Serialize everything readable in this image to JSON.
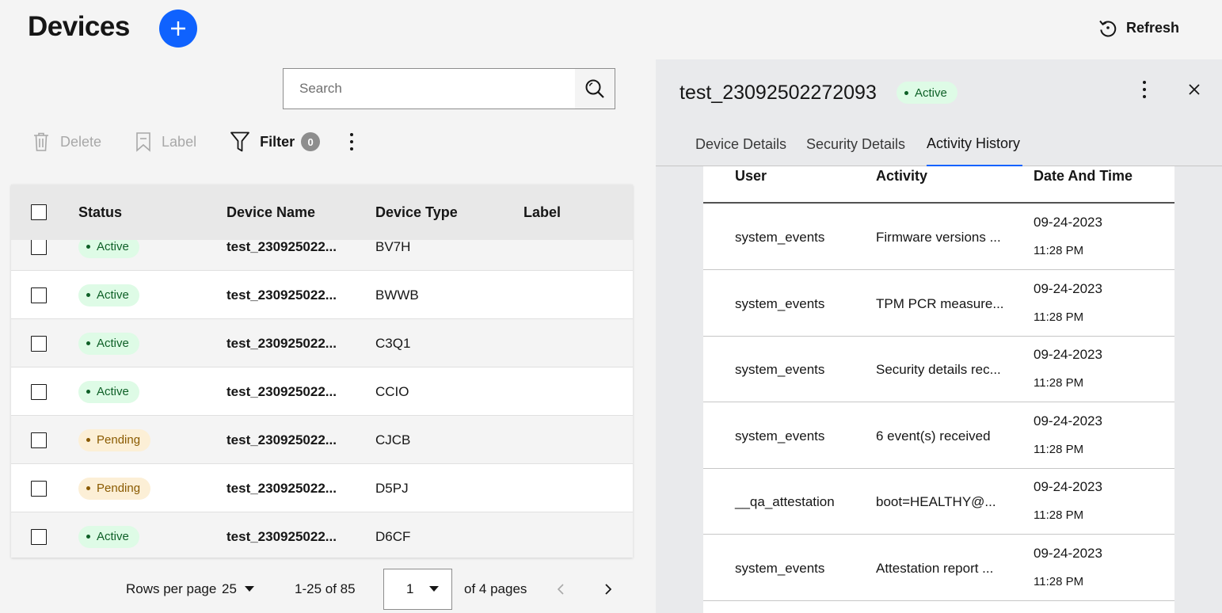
{
  "header": {
    "title": "Devices",
    "refresh_label": "Refresh"
  },
  "search": {
    "placeholder": "Search"
  },
  "toolbar": {
    "delete_label": "Delete",
    "label_label": "Label",
    "filter_label": "Filter",
    "filter_count": "0"
  },
  "table": {
    "columns": [
      "Status",
      "Device Name",
      "Device Type",
      "Label"
    ],
    "rows": [
      {
        "status": "Active",
        "name": "test_230925022...",
        "type": "BV7H",
        "label": ""
      },
      {
        "status": "Active",
        "name": "test_230925022...",
        "type": "BWWB",
        "label": ""
      },
      {
        "status": "Active",
        "name": "test_230925022...",
        "type": "C3Q1",
        "label": ""
      },
      {
        "status": "Active",
        "name": "test_230925022...",
        "type": "CCIO",
        "label": ""
      },
      {
        "status": "Pending",
        "name": "test_230925022...",
        "type": "CJCB",
        "label": ""
      },
      {
        "status": "Pending",
        "name": "test_230925022...",
        "type": "D5PJ",
        "label": ""
      },
      {
        "status": "Active",
        "name": "test_230925022...",
        "type": "D6CF",
        "label": ""
      }
    ]
  },
  "pagination": {
    "rows_per_page_label": "Rows per page",
    "rows_per_page": "25",
    "range": "1-25 of 85",
    "page": "1",
    "of_pages": "of 4 pages"
  },
  "panel": {
    "device_name": "test_23092502272093",
    "status": "Active",
    "tabs": [
      "Device Details",
      "Security Details",
      "Activity History"
    ],
    "selected_tab": "Activity History",
    "activity_columns": [
      "User",
      "Activity",
      "Date And Time"
    ],
    "activity_rows": [
      {
        "user": "system_events",
        "activity": "Firmware versions ...",
        "date": "09-24-2023",
        "time": "11:28 PM"
      },
      {
        "user": "system_events",
        "activity": "TPM PCR measure...",
        "date": "09-24-2023",
        "time": "11:28 PM"
      },
      {
        "user": "system_events",
        "activity": "Security details rec...",
        "date": "09-24-2023",
        "time": "11:28 PM"
      },
      {
        "user": "system_events",
        "activity": "6 event(s) received",
        "date": "09-24-2023",
        "time": "11:28 PM"
      },
      {
        "user": "__qa_attestation",
        "activity": "boot=HEALTHY@...",
        "date": "09-24-2023",
        "time": "11:28 PM"
      },
      {
        "user": "system_events",
        "activity": "Attestation report ...",
        "date": "09-24-2023",
        "time": "11:28 PM"
      }
    ]
  },
  "colors": {
    "primary": "#0f62fe",
    "active_bg": "#defbe6",
    "active_fg": "#0e6027",
    "pending_bg": "#fcefd6",
    "pending_fg": "#8a5a00"
  },
  "icons": {
    "add": "plus-icon",
    "refresh": "refresh-icon",
    "search": "search-icon",
    "delete": "trash-icon",
    "label": "bookmark-icon",
    "filter": "filter-icon",
    "more": "overflow-menu-icon",
    "close": "close-icon",
    "page_dropdown": "caret-down-icon",
    "prev": "chevron-left-icon",
    "next": "chevron-right-icon"
  }
}
